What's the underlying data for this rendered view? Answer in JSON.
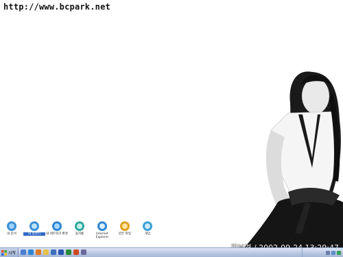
{
  "watermark": "http://www.bcpark.net",
  "caption": "김보경 / 2002-09-24 13:29:47",
  "desktop_icons": [
    {
      "label": "내 문서",
      "icon": "my-documents-icon",
      "selected": false
    },
    {
      "label": "내 컴퓨터",
      "icon": "my-computer-icon",
      "selected": true
    },
    {
      "label": "내 네트워크 환경",
      "icon": "network-icon",
      "selected": false
    },
    {
      "label": "휴지통",
      "icon": "recycle-bin-icon",
      "selected": false
    },
    {
      "label": "Internet Explorer",
      "icon": "internet-explorer-icon",
      "selected": false
    },
    {
      "label": "받은 파일",
      "icon": "received-files-icon",
      "selected": false
    },
    {
      "label": "게임",
      "icon": "games-icon",
      "selected": false
    }
  ],
  "taskbar": {
    "start_label": "시작",
    "quick_launch": [
      "desktop-icon",
      "ie-icon",
      "media-icon",
      "folder-icon",
      "outlook-icon",
      "word-icon",
      "excel-icon",
      "powerpoint-icon",
      "app-icon"
    ],
    "tray": [
      "volume-icon",
      "network-tray-icon",
      "messenger-icon"
    ]
  }
}
